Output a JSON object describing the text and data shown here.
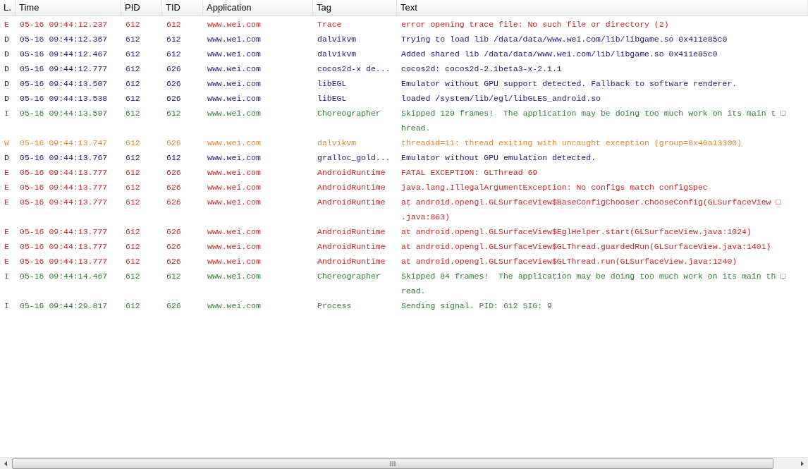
{
  "columns": [
    "L.",
    "Time",
    "PID",
    "TID",
    "Application",
    "Tag",
    "Text"
  ],
  "rows": [
    {
      "kind": "error",
      "level_letter": "E",
      "time": "05-16 09:44:12.237",
      "pid": "612",
      "tid": "612",
      "application": "www.wei.com",
      "tag": "Trace",
      "text": [
        "error opening trace file: No such file or directory (2)"
      ]
    },
    {
      "kind": "debug",
      "level_letter": "D",
      "time": "05-16 09:44:12.367",
      "pid": "612",
      "tid": "612",
      "application": "www.wei.com",
      "tag": "dalvikvm",
      "text": [
        "Trying to load lib /data/data/www.wei.com/lib/libgame.so 0x411e85c0"
      ]
    },
    {
      "kind": "debug",
      "level_letter": "D",
      "time": "05-16 09:44:12.467",
      "pid": "612",
      "tid": "612",
      "application": "www.wei.com",
      "tag": "dalvikvm",
      "text": [
        "Added shared lib /data/data/www.wei.com/lib/libgame.so 0x411e85c0"
      ]
    },
    {
      "kind": "debug",
      "level_letter": "D",
      "time": "05-16 09:44:12.777",
      "pid": "612",
      "tid": "626",
      "application": "www.wei.com",
      "tag": "cocos2d-x de...",
      "text": [
        "cocos2d: cocos2d-2.1beta3-x-2.1.1"
      ]
    },
    {
      "kind": "debug",
      "level_letter": "D",
      "time": "05-16 09:44:13.507",
      "pid": "612",
      "tid": "626",
      "application": "www.wei.com",
      "tag": "libEGL",
      "text": [
        "Emulator without GPU support detected. Fallback to software renderer."
      ]
    },
    {
      "kind": "debug",
      "level_letter": "D",
      "time": "05-16 09:44:13.538",
      "pid": "612",
      "tid": "626",
      "application": "www.wei.com",
      "tag": "libEGL",
      "text": [
        "loaded /system/lib/egl/libGLES_android.so"
      ]
    },
    {
      "kind": "info",
      "level_letter": "I",
      "time": "05-16 09:44:13.597",
      "pid": "612",
      "tid": "612",
      "application": "www.wei.com",
      "tag": "Choreographer",
      "text": [
        "Skipped 129 frames!  The application may be doing too much work on its main t □",
        "hread."
      ]
    },
    {
      "kind": "warning",
      "level_letter": "W",
      "time": "05-16 09:44:13.747",
      "pid": "612",
      "tid": "626",
      "application": "www.wei.com",
      "tag": "dalvikvm",
      "text": [
        "threadid=11: thread exiting with uncaught exception (group=0x40a13300)"
      ]
    },
    {
      "kind": "debug",
      "level_letter": "D",
      "time": "05-16 09:44:13.767",
      "pid": "612",
      "tid": "612",
      "application": "www.wei.com",
      "tag": "gralloc_gold...",
      "text": [
        "Emulator without GPU emulation detected."
      ]
    },
    {
      "kind": "error",
      "level_letter": "E",
      "time": "05-16 09:44:13.777",
      "pid": "612",
      "tid": "626",
      "application": "www.wei.com",
      "tag": "AndroidRuntime",
      "text": [
        "FATAL EXCEPTION: GLThread 69"
      ]
    },
    {
      "kind": "error",
      "level_letter": "E",
      "time": "05-16 09:44:13.777",
      "pid": "612",
      "tid": "626",
      "application": "www.wei.com",
      "tag": "AndroidRuntime",
      "text": [
        "java.lang.IllegalArgumentException: No configs match configSpec"
      ]
    },
    {
      "kind": "error",
      "level_letter": "E",
      "time": "05-16 09:44:13.777",
      "pid": "612",
      "tid": "626",
      "application": "www.wei.com",
      "tag": "AndroidRuntime",
      "text": [
        "at android.opengl.GLSurfaceView$BaseConfigChooser.chooseConfig(GLSurfaceView □",
        ".java:863)"
      ]
    },
    {
      "kind": "error",
      "level_letter": "E",
      "time": "05-16 09:44:13.777",
      "pid": "612",
      "tid": "626",
      "application": "www.wei.com",
      "tag": "AndroidRuntime",
      "text": [
        "at android.opengl.GLSurfaceView$EglHelper.start(GLSurfaceView.java:1024)"
      ]
    },
    {
      "kind": "error",
      "level_letter": "E",
      "time": "05-16 09:44:13.777",
      "pid": "612",
      "tid": "626",
      "application": "www.wei.com",
      "tag": "AndroidRuntime",
      "text": [
        "at android.opengl.GLSurfaceView$GLThread.guardedRun(GLSurfaceView.java:1401)"
      ]
    },
    {
      "kind": "error",
      "level_letter": "E",
      "time": "05-16 09:44:13.777",
      "pid": "612",
      "tid": "626",
      "application": "www.wei.com",
      "tag": "AndroidRuntime",
      "text": [
        "at android.opengl.GLSurfaceView$GLThread.run(GLSurfaceView.java:1240)"
      ]
    },
    {
      "kind": "info",
      "level_letter": "I",
      "time": "05-16 09:44:14.467",
      "pid": "612",
      "tid": "612",
      "application": "www.wei.com",
      "tag": "Choreographer",
      "text": [
        "Skipped 84 frames!  The application may be doing too much work on its main th □",
        "read."
      ]
    },
    {
      "kind": "info",
      "level_letter": "I",
      "time": "05-16 09:44:29.817",
      "pid": "612",
      "tid": "626",
      "application": "www.wei.com",
      "tag": "Process",
      "text": [
        "Sending signal. PID: 612 SIG: 9"
      ]
    }
  ]
}
